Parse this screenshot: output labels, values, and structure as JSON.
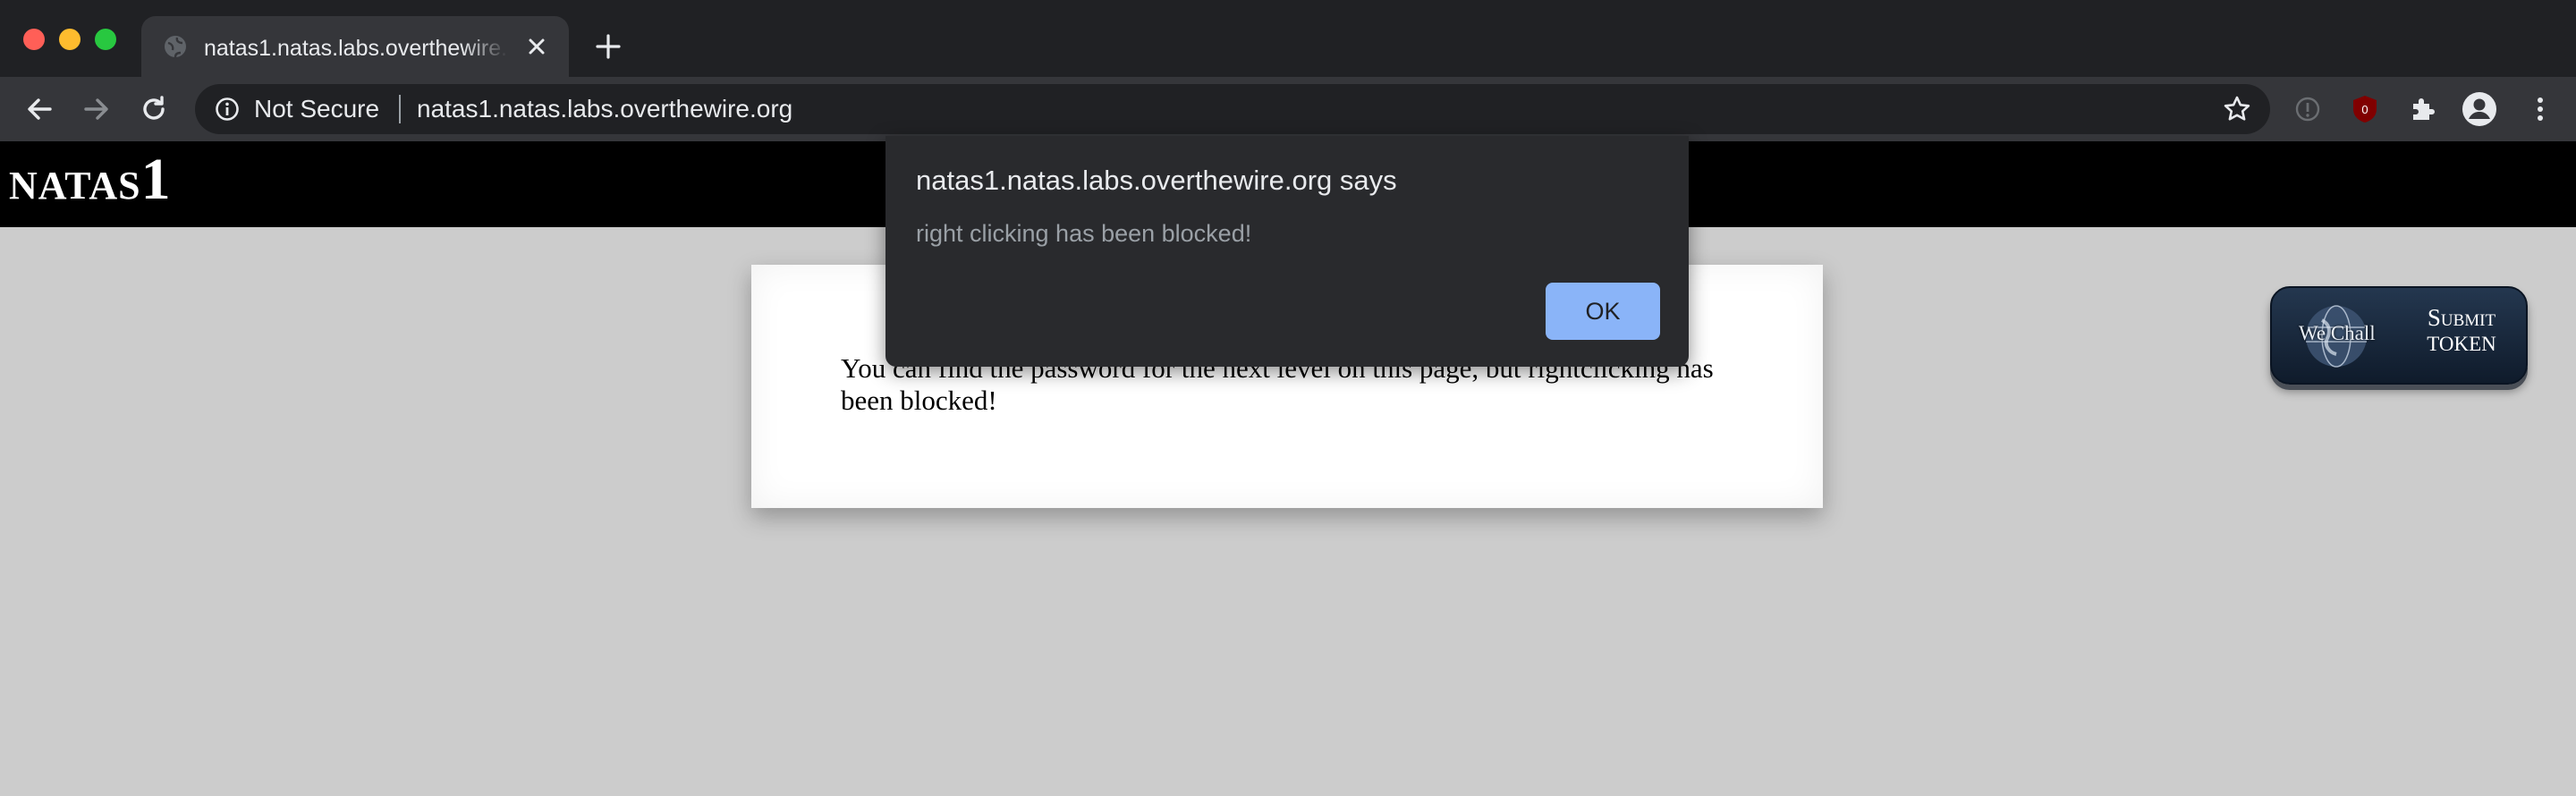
{
  "browser": {
    "tab_title": "natas1.natas.labs.overthewire.org",
    "security_label": "Not Secure",
    "url": "natas1.natas.labs.overthewire.org",
    "extension_badge": "0"
  },
  "page": {
    "logo_prefix": "NATAS",
    "logo_number": "1",
    "content_text": "You can find the password for the next level on this page, but rightclicking has been blocked!",
    "wechall": {
      "badge_text": "We Chall",
      "submit_line1": "Submit",
      "submit_line2": "TOKEN"
    }
  },
  "alert": {
    "title": "natas1.natas.labs.overthewire.org says",
    "message": "right clicking has been blocked!",
    "ok_label": "OK"
  },
  "colors": {
    "page_background": "#cccccc",
    "header_background": "#000000",
    "dialog_background": "#292a2d",
    "ok_button": "#8ab4f8"
  }
}
